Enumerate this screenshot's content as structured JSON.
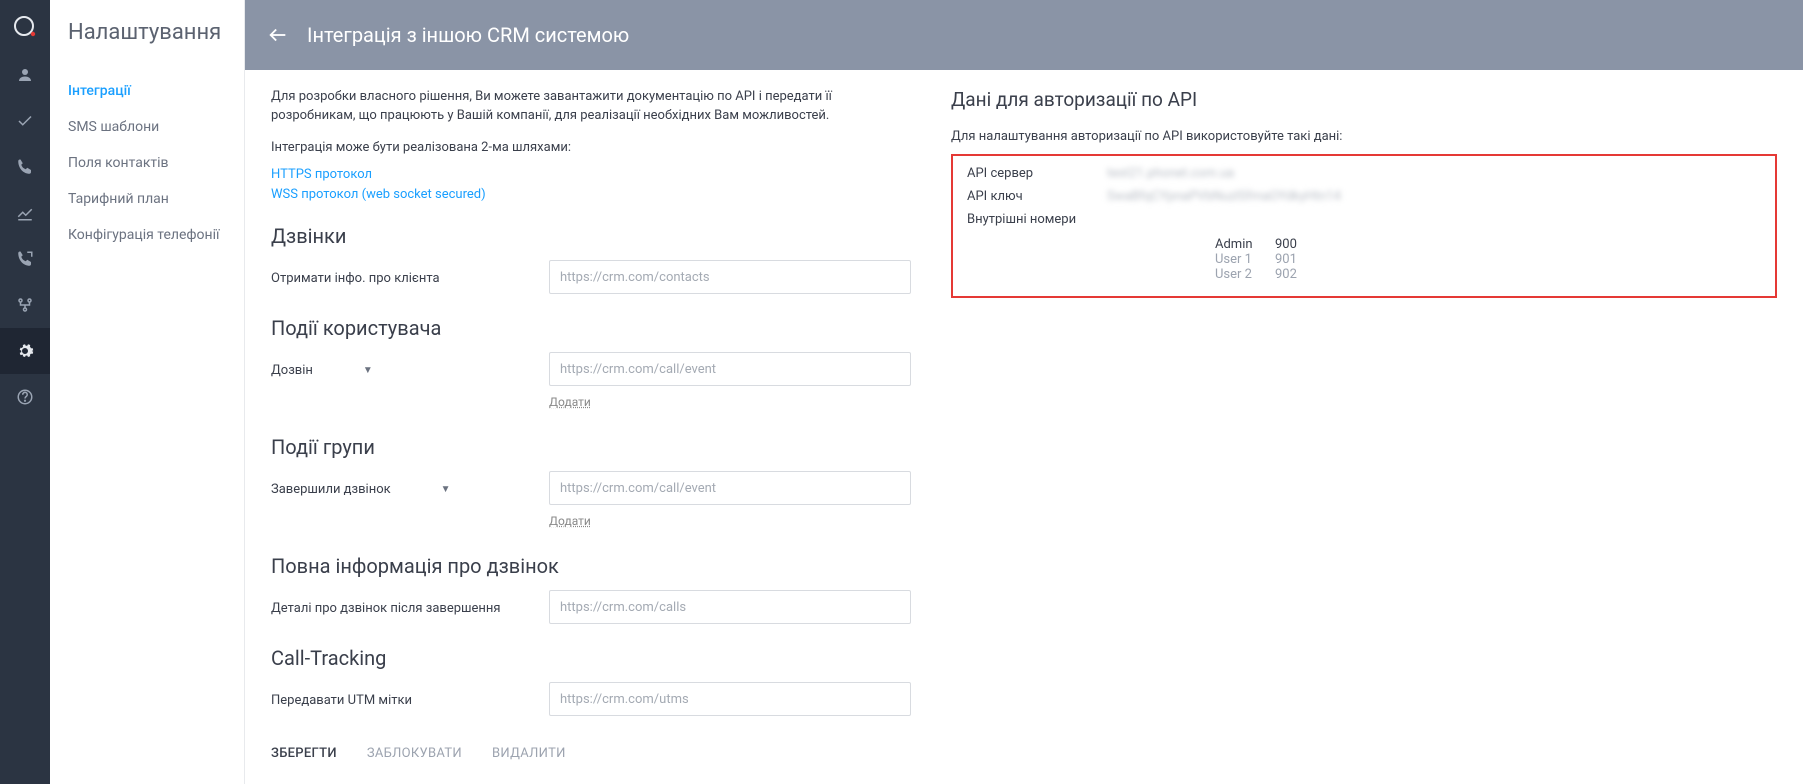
{
  "rail_icons": [
    "user",
    "check",
    "phone",
    "chart",
    "call-out",
    "branch",
    "gear",
    "help"
  ],
  "settings": {
    "title": "Налаштування",
    "menu": [
      "Інтеграції",
      "SMS шаблони",
      "Поля контактів",
      "Тарифний план",
      "Конфігурація телефонії"
    ],
    "active_index": 0
  },
  "header": {
    "title": "Інтеграція з іншою CRM системою"
  },
  "intro": {
    "p1": "Для розробки власного рішення, Ви можете завантажити документацію по API і передати її розробникам, що працюють у Вашій компанії, для реалізації необхідних Вам можливостей.",
    "p2": "Інтеграція може бути реалізована 2-ма шляхами:",
    "link1": "HTTPS протокол",
    "link2": "WSS протокол (web socket secured)"
  },
  "sections": {
    "calls": {
      "heading": "Дзвінки",
      "row1_label": "Отримати інфо. про клієнта",
      "row1_ph": "https://crm.com/contacts"
    },
    "user_events": {
      "heading": "Події користувача",
      "row1_label": "Дозвін",
      "row1_ph": "https://crm.com/call/event",
      "add": "Додати"
    },
    "group_events": {
      "heading": "Події групи",
      "row1_label": "Завершили дзвінок",
      "row1_ph": "https://crm.com/call/event",
      "add": "Додати"
    },
    "full_info": {
      "heading": "Повна інформація про дзвінок",
      "row1_label": "Деталі про дзвінок після завершення",
      "row1_ph": "https://crm.com/calls"
    },
    "call_tracking": {
      "heading": "Call-Tracking",
      "row1_label": "Передавати UTM мітки",
      "row1_ph": "https://crm.com/utms"
    }
  },
  "actions": {
    "save": "ЗБЕРЕГТИ",
    "block": "ЗАБЛОКУВАТИ",
    "delete": "ВИДАЛИТИ"
  },
  "api_panel": {
    "heading": "Дані для авторизації по API",
    "note": "Для налаштування авторизації по API використовуйте такі дані:",
    "server_label": "API сервер",
    "server_value": "test21.phonet.com.ua",
    "key_label": "API ключ",
    "key_value": "SwaBfqCYpnaPVbNuzlSfmaOYdkyHtn14",
    "ext_label": "Внутрішні номери",
    "extensions": [
      {
        "name": "Admin",
        "num": "900"
      },
      {
        "name": "User 1",
        "num": "901"
      },
      {
        "name": "User 2",
        "num": "902"
      }
    ]
  }
}
